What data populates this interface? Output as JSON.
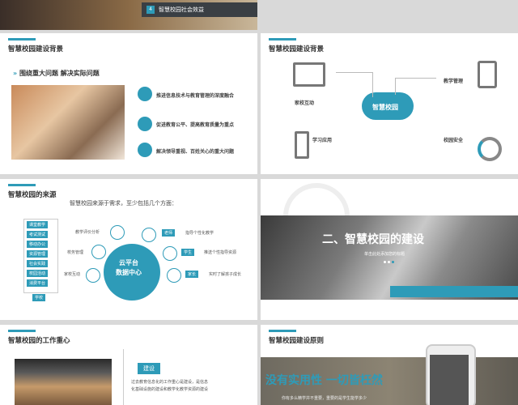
{
  "s1": {
    "number": "4",
    "title": "智慧校园社会效益"
  },
  "s2": {
    "title": "智慧校园建设背景",
    "heading": "围绕重大问题  解决实际问题",
    "points": [
      "推进信息技术与教育管理的深度融合",
      "促进教育公平、提高教育质量为重点",
      "解决领导重视、百姓关心的重大问题"
    ]
  },
  "s3": {
    "title": "智慧校园建设背景",
    "cloud": "智慧校园",
    "labels": {
      "home": "家校互动",
      "teach": "教学管理",
      "study": "学习应用",
      "safe": "校园安全"
    }
  },
  "s4": {
    "title": "智慧校园的来源",
    "subtitle": "智慧校园来源于需求，至少包括几个方面：",
    "menu": [
      "课堂教学",
      "考试测试",
      "移动办公",
      "资源管理",
      "社会实践",
      "校园活动",
      "消费平台"
    ],
    "school": "学校",
    "center": [
      "云平台",
      "数据中心"
    ],
    "left": [
      "教学评价分析",
      "校务管理",
      "家校互动"
    ],
    "right_tags": [
      "老师",
      "学生",
      "家长"
    ],
    "right_text": [
      "指导个性化教学",
      "推送个性指导资源",
      "实时了解孩子成长"
    ]
  },
  "s5": {
    "title": "二、智慧校园的建设",
    "subtitle": "单击此处添加您的标题"
  },
  "s6": {
    "title": "智慧校园的工作重心",
    "tag": "建设",
    "text": [
      "过去教育信息化的工作重心是建设，是信息",
      "化基础设施的建设和教学化教学资源的建设"
    ]
  },
  "s7": {
    "title": "智慧校园建设原则",
    "headline": "没有实用性  一切皆枉然",
    "sub": "你有多么精学并不重要，重要的是学生能学多少"
  }
}
